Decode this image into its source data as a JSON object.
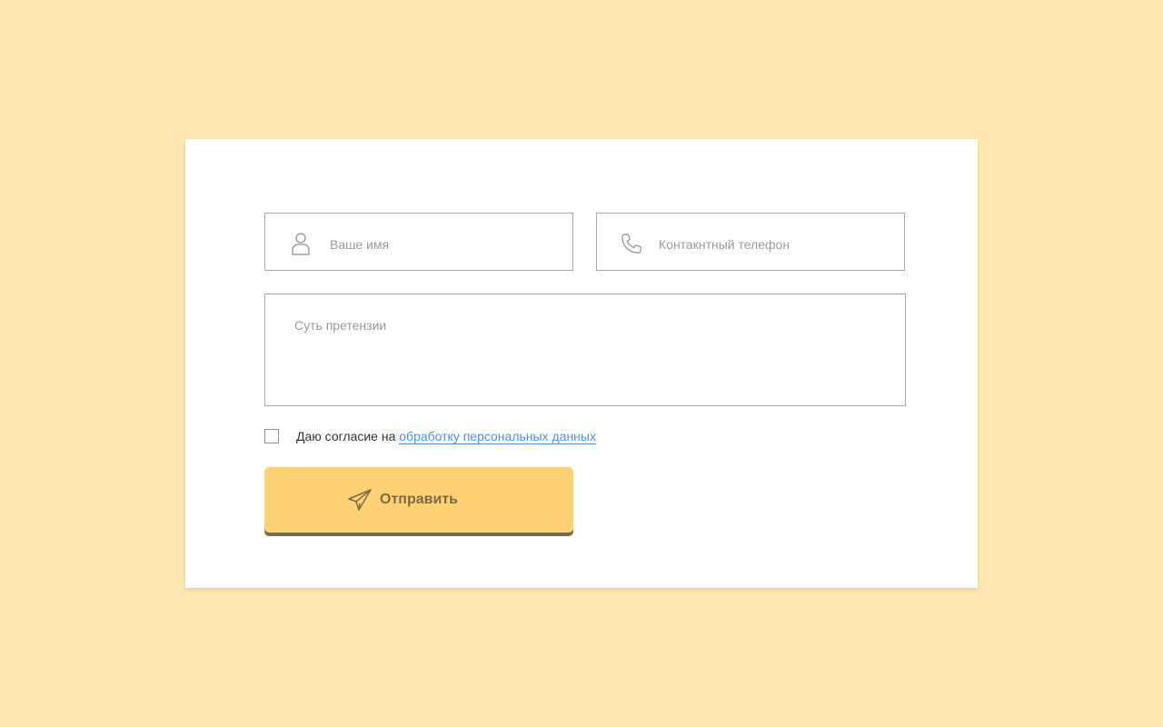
{
  "colors": {
    "background": "#ffe5b0",
    "card": "#ffffff",
    "button": "#ffd175",
    "button_shadow": "#7a6a48",
    "link": "#4e8df0",
    "placeholder": "#9a9a9a",
    "border": "#a7a7a7"
  },
  "form": {
    "name_field": {
      "placeholder": "Ваше имя",
      "value": "",
      "icon": "user-icon"
    },
    "phone_field": {
      "placeholder": "Контакнтный телефон",
      "value": "",
      "icon": "phone-icon"
    },
    "message_field": {
      "placeholder": "Суть претензии",
      "value": ""
    },
    "consent": {
      "checked": false,
      "text": "Даю согласие на",
      "link_text": "обработку персональных данных"
    },
    "submit": {
      "label": "Отправить",
      "icon": "send-icon"
    }
  }
}
